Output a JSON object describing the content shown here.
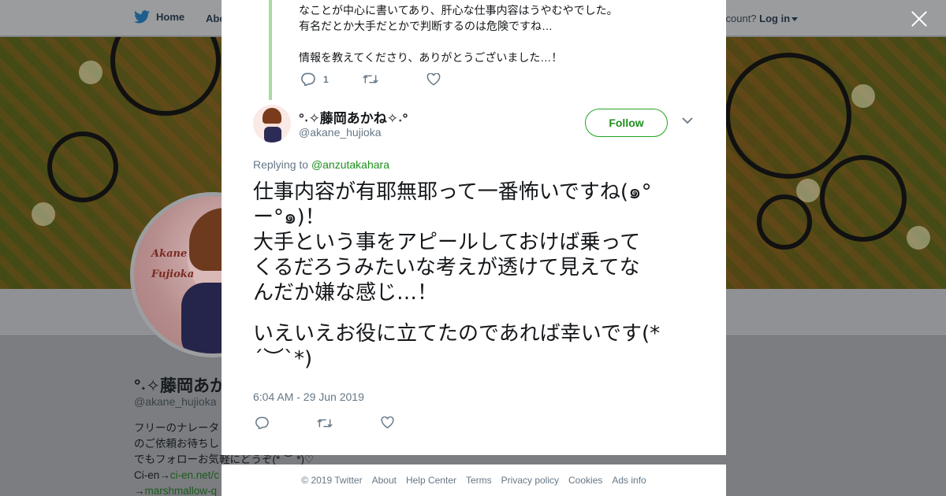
{
  "colors": {
    "accent": "#1e8f1e",
    "follow_border": "#21a321",
    "overlay": "#7d7f82",
    "text": "#14171a",
    "muted": "#657786"
  },
  "topnav": {
    "home_label": "Home",
    "about_label": "Abo",
    "login_prompt": "ccount?",
    "login_label": "Log in"
  },
  "background_profile": {
    "avatar_text_1": "Akane",
    "avatar_text_2": "Fujioka",
    "name": "°˖✧藤岡あか",
    "handle": "@akane_hujioka",
    "bio_lines": [
      "フリーのナレータ",
      "のご依頼お待ちし",
      "でもフォローお気軽にどうぞ(* ︶ *)♡"
    ],
    "cien_prefix": "Ci-en→",
    "cien_link": "ci-en.net/c",
    "marsh_prefix": "→",
    "marsh_link": "marshmallow-q"
  },
  "parent_tweet": {
    "lines": [
      "なことが中心に書いてあり、肝心な仕事内容はうやむやでした。",
      "有名だとか大手だとかで判断するのは危険ですね…",
      "",
      "情報を教えてくださり、ありがとうございました…！"
    ],
    "reply_count": "1",
    "icons": {
      "reply": "reply-icon",
      "retweet": "retweet-icon",
      "like": "heart-icon"
    }
  },
  "tweet": {
    "display_name": "°˖✧藤岡あかね✧˖°",
    "handle": "@akane_hujioka",
    "follow_label": "Follow",
    "replying_prefix": "Replying to",
    "replying_to": "@anzutakahara",
    "text_lines": [
      "仕事内容が有耶無耶って一番怖いですね(๑°",
      "ー°๑)！",
      "大手という事をアピールしておけば乗って",
      "くるだろうみたいな考えが透けて見えてな",
      "んだか嫌な感じ…！",
      "",
      "いえいえお役に立てたのであれば幸いです(*",
      "´︶`*)"
    ],
    "timestamp": "6:04 AM - 29 Jun 2019"
  },
  "footer": {
    "copyright": "© 2019 Twitter",
    "links": [
      "About",
      "Help Center",
      "Terms",
      "Privacy policy",
      "Cookies",
      "Ads info"
    ]
  }
}
